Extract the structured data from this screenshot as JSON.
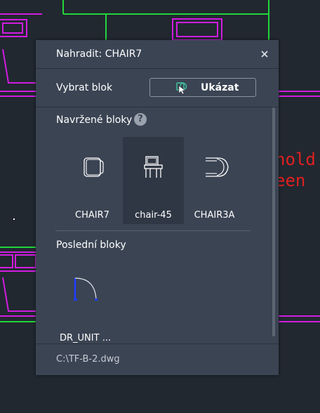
{
  "cad_text": "nold\neen",
  "dialog": {
    "title": "Nahradit: CHAIR7",
    "close_icon": "close-icon",
    "select_block_label": "Vybrat blok",
    "show_button_label": "Ukázat",
    "show_button_icon": "pick-block-icon",
    "suggested_title": "Navržené bloky",
    "help_icon": "help-icon",
    "help_glyph": "?",
    "suggested_blocks": [
      {
        "name": "CHAIR7",
        "icon": "chair7-block-icon",
        "selected": false
      },
      {
        "name": "chair-45",
        "icon": "chair-45-block-icon",
        "selected": true
      },
      {
        "name": "CHAIR3A",
        "icon": "chair3a-block-icon",
        "selected": false
      }
    ],
    "recent_title": "Poslední bloky",
    "recent_blocks": [
      {
        "name": "DR_UNIT ...",
        "icon": "door-block-icon"
      }
    ],
    "file_path": "C:\\TF-B-2.dwg"
  },
  "colors": {
    "cad_background": "#212830",
    "cad_magenta": "#d21ce0",
    "cad_green": "#22d63a",
    "cad_red": "#e02020",
    "panel": "#3b4453",
    "panel_selected": "#2f3744",
    "door_blue": "#1f3cff"
  }
}
